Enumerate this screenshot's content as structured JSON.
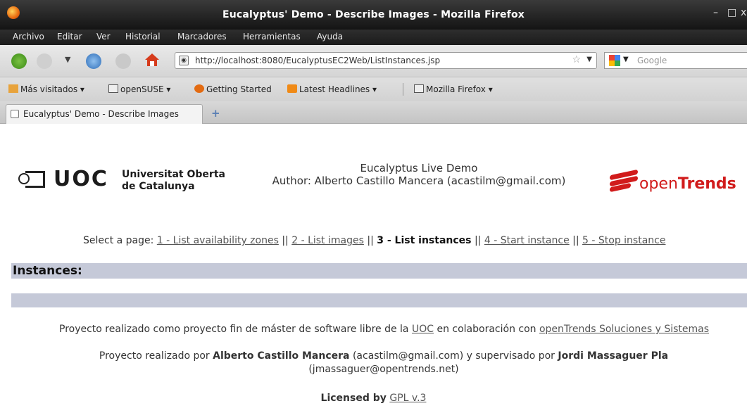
{
  "window": {
    "title": "Eucalyptus' Demo - Describe Images - Mozilla Firefox",
    "min": "–",
    "max": "□",
    "close": "x"
  },
  "menu": [
    "Archivo",
    "Editar",
    "Ver",
    "Historial",
    "Marcadores",
    "Herramientas",
    "Ayuda"
  ],
  "nav": {
    "url": "http://localhost:8080/EucalyptusEC2Web/ListInstances.jsp",
    "search_placeholder": "Google"
  },
  "bookmarks": [
    "Más visitados",
    "openSUSE",
    "Getting Started",
    "Latest Headlines",
    "Mozilla Firefox"
  ],
  "tab": {
    "label": "Eucalyptus' Demo - Describe Images",
    "new_tab": "+"
  },
  "header": {
    "uoc_letters": "UOC",
    "uoc_name_1": "Universitat Oberta",
    "uoc_name_2": "de Catalunya",
    "demo_title": "Eucalyptus Live Demo",
    "author": "Author: Alberto Castillo Mancera (acastilm@gmail.com)",
    "brand_a": "open",
    "brand_b": "Trends"
  },
  "page_select": {
    "prefix": "Select a page: ",
    "link1": "1 - List availability zones",
    "link2": "2 - List images",
    "current": "3 - List instances",
    "link4": "4 - Start instance",
    "link5": "5 - Stop instance",
    "sep": " || "
  },
  "section": {
    "title": "Instances:"
  },
  "footer": {
    "line1_a": "Proyecto realizado como proyecto fin de máster de software libre de la ",
    "line1_uoc": "UOC",
    "line1_b": " en colaboración con ",
    "line1_ot": "openTrends Soluciones y Sistemas",
    "line2_a": "Proyecto realizado por ",
    "line2_name1": "Alberto Castillo Mancera",
    "line2_b": " (acastilm@gmail.com) y supervisado por ",
    "line2_name2": "Jordi Massaguer Pla",
    "line2_c": " (jmassaguer@opentrends.net)",
    "licensed_by": "Licensed by",
    "license": "GPL v.3"
  }
}
